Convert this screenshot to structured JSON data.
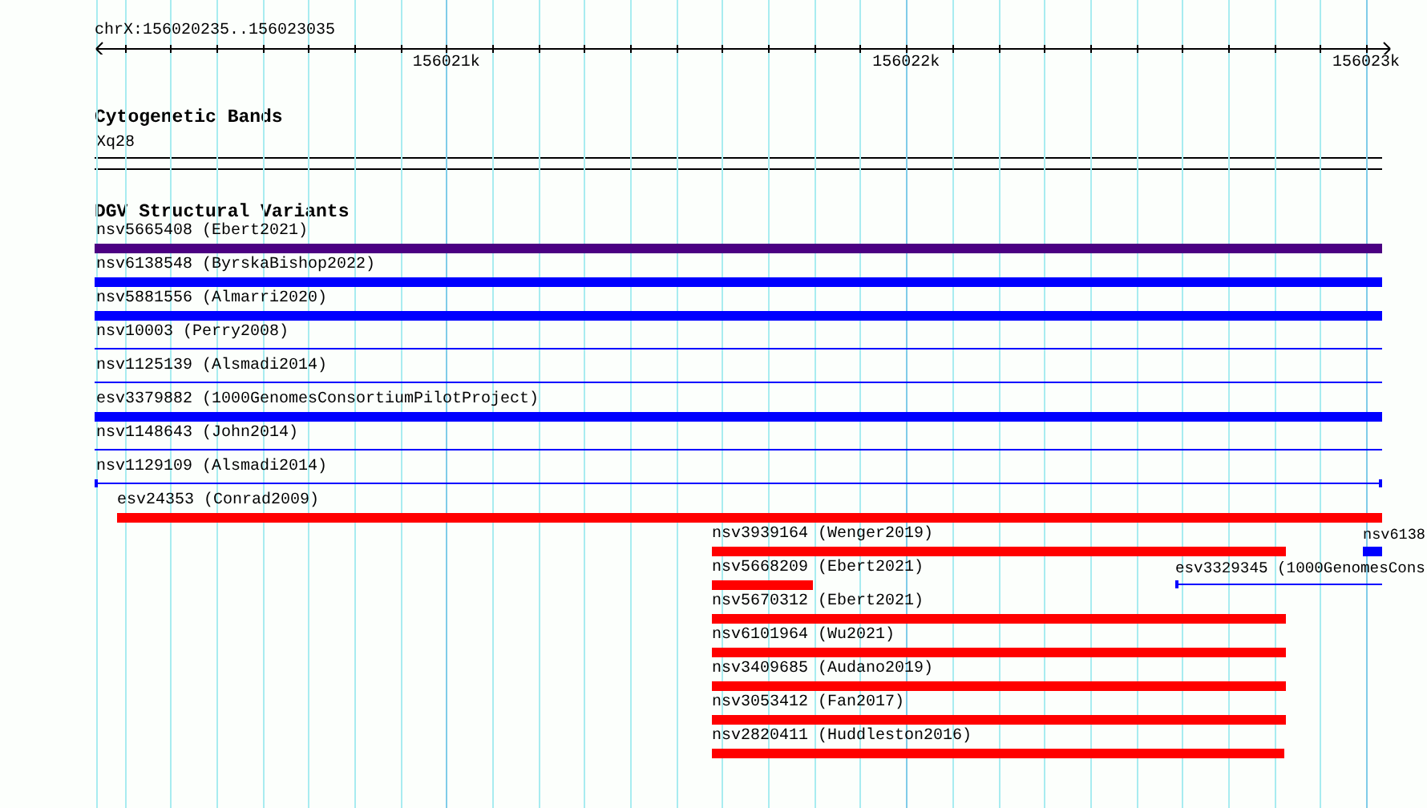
{
  "ruler": {
    "location": "chrX:156020235..156023035",
    "ticks": [
      {
        "label": "156021k"
      },
      {
        "label": "156022k"
      },
      {
        "label": "156023k"
      }
    ]
  },
  "cytogenetic_bands": {
    "title": "Cytogenetic Bands",
    "bands": [
      {
        "label": "Xq28"
      }
    ]
  },
  "structural_variants": {
    "title": "DGV Structural Variants",
    "rows": [
      [
        {
          "label": "nsv5665408 (Ebert2021)",
          "kind": "thick",
          "color": "#4b0082"
        }
      ],
      [
        {
          "label": "nsv6138548 (ByrskaBishop2022)",
          "kind": "thick",
          "color": "#0000ff"
        }
      ],
      [
        {
          "label": "nsv5881556 (Almarri2020)",
          "kind": "thick",
          "color": "#0000ff"
        }
      ],
      [
        {
          "label": "nsv10003 (Perry2008)",
          "kind": "thin",
          "color": "#0000ff"
        }
      ],
      [
        {
          "label": "nsv1125139 (Alsmadi2014)",
          "kind": "thin",
          "color": "#0000ff"
        }
      ],
      [
        {
          "label": "esv3379882 (1000GenomesConsortiumPilotProject)",
          "kind": "thick",
          "color": "#0000ff"
        }
      ],
      [
        {
          "label": "nsv1148643 (John2014)",
          "kind": "thin",
          "color": "#0000ff"
        }
      ],
      [
        {
          "label": "nsv1129109 (Alsmadi2014)",
          "kind": "thin",
          "color": "#0000ff"
        }
      ],
      [
        {
          "label": "esv24353 (Conrad2009)",
          "kind": "thick",
          "color": "#ff0000"
        }
      ],
      [
        {
          "label": "nsv3939164 (Wenger2019)",
          "kind": "thick",
          "color": "#ff0000"
        },
        {
          "label": "nsv6138",
          "kind": "thick",
          "color": "#0000ff"
        }
      ],
      [
        {
          "label": "nsv5668209 (Ebert2021)",
          "kind": "thick",
          "color": "#ff0000"
        },
        {
          "label": "esv3329345 (1000GenomesCons",
          "kind": "thin",
          "color": "#0000ff"
        }
      ],
      [
        {
          "label": "nsv5670312 (Ebert2021)",
          "kind": "thick",
          "color": "#ff0000"
        }
      ],
      [
        {
          "label": "nsv6101964 (Wu2021)",
          "kind": "thick",
          "color": "#ff0000"
        }
      ],
      [
        {
          "label": "nsv3409685 (Audano2019)",
          "kind": "thick",
          "color": "#ff0000"
        }
      ],
      [
        {
          "label": "nsv3053412 (Fan2017)",
          "kind": "thick",
          "color": "#ff0000"
        }
      ],
      [
        {
          "label": "nsv2820411 (Huddleston2016)",
          "kind": "thick",
          "color": "#ff0000"
        }
      ]
    ]
  }
}
